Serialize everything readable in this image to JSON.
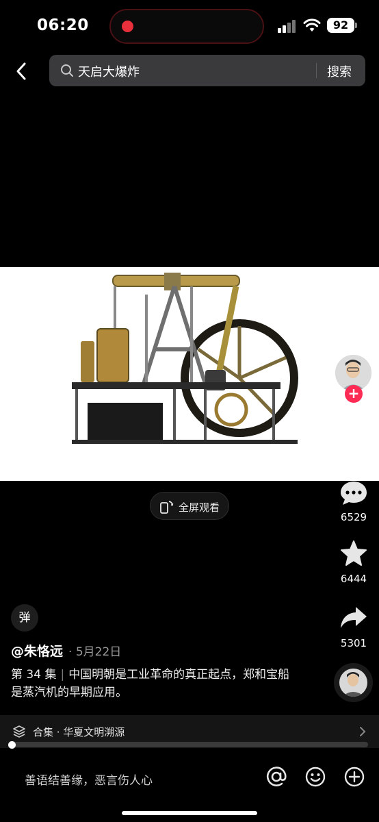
{
  "status_bar": {
    "time": "06:20",
    "battery": "92"
  },
  "header": {
    "search_query": "天启大爆炸",
    "search_button": "搜索"
  },
  "video": {
    "fullscreen_label": "全屏观看"
  },
  "rail": {
    "comment_count": "6529",
    "favorite_count": "6444",
    "share_count": "5301"
  },
  "caption": {
    "danmaku_label": "弹",
    "author": "@朱恪远",
    "date": "· 5月22日",
    "episode": "第 34 集",
    "text": "中国明朝是工业革命的真正起点，郑和宝船是蒸汽机的早期应用。"
  },
  "collection": {
    "label": "合集 · 华夏文明溯源",
    "progress": 0.01
  },
  "comment_bar": {
    "placeholder": "善语结善缘，恶言伤人心"
  },
  "colors": {
    "background": "#000000",
    "follow_accent": "#fe2c55",
    "search_field": "#3a3a3c"
  }
}
